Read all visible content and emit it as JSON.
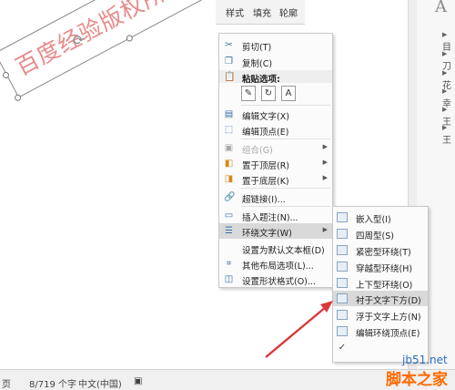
{
  "ribbon": {
    "style_label": "样式",
    "fill_label": "填充",
    "outline_label": "轮廓"
  },
  "shape": {
    "text": "百度经验版权所有"
  },
  "context_menu": {
    "items": [
      {
        "label": "剪切(T)",
        "icon": "scissors-icon"
      },
      {
        "label": "复制(C)",
        "icon": "copy-icon"
      },
      {
        "label": "粘贴选项:",
        "icon": "paste-icon"
      },
      {
        "label": "编辑文字(X)",
        "icon": "edit-text-icon"
      },
      {
        "label": "编辑顶点(E)",
        "icon": "edit-points-icon"
      },
      {
        "label": "组合(G)",
        "icon": "group-icon",
        "disabled": true
      },
      {
        "label": "置于顶层(R)",
        "icon": "bring-front-icon"
      },
      {
        "label": "置于底层(K)",
        "icon": "send-back-icon"
      },
      {
        "label": "超链接(I)...",
        "icon": "hyperlink-icon"
      },
      {
        "label": "插入题注(N)...",
        "icon": "caption-icon"
      },
      {
        "label": "环绕文字(W)",
        "icon": "wrap-text-icon"
      },
      {
        "label": "设置为默认文本框(D)",
        "icon": ""
      },
      {
        "label": "其他布局选项(L)...",
        "icon": "layout-icon"
      },
      {
        "label": "设置形状格式(O)...",
        "icon": "format-shape-icon"
      }
    ],
    "paste_glyphs": [
      "✎",
      "↻",
      "A"
    ]
  },
  "wrap_submenu": {
    "items": [
      {
        "label": "嵌入型(I)"
      },
      {
        "label": "四周型(S)"
      },
      {
        "label": "紧密型环绕(T)"
      },
      {
        "label": "穿越型环绕(H)"
      },
      {
        "label": "上下型环绕(O)"
      },
      {
        "label": "衬于文字下方(D)"
      },
      {
        "label": "浮于文字上方(N)"
      },
      {
        "label": "编辑环绕顶点(E)"
      }
    ]
  },
  "right_pane": {
    "top_char": "A",
    "rows": [
      "目",
      "刀",
      "花",
      "幸",
      "王",
      "王"
    ]
  },
  "status_bar": {
    "page_text": "页",
    "words_text": "8/719 个字",
    "lang_text": "中文(中国)"
  },
  "watermark": {
    "site": "jb51.net",
    "brand": "脚本之家"
  },
  "colors": {
    "arrow": "#d9393b",
    "shape_text": "#e88a8a",
    "menu_highlight": "#d9d9d9",
    "watermark_orange": "#ff6a00",
    "watermark_blue": "#2a6fbf"
  }
}
